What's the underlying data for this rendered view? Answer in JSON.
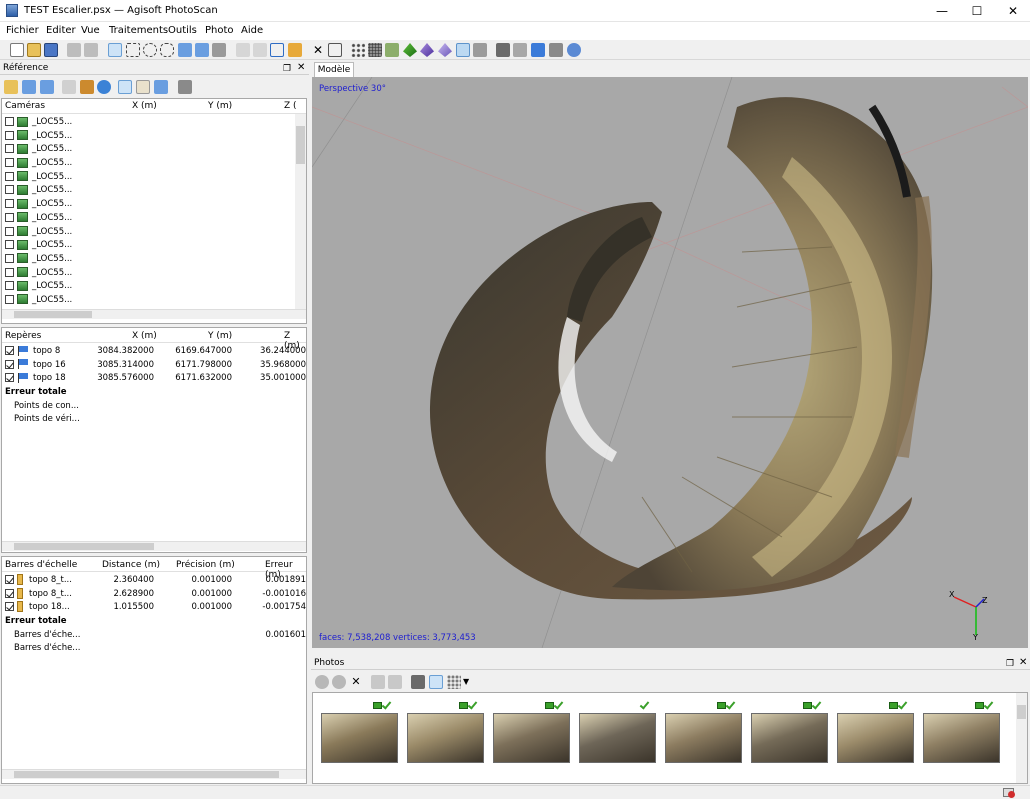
{
  "window": {
    "title": "TEST Escalier.psx — Agisoft PhotoScan",
    "min_icon": "minimize-icon",
    "max_icon": "maximize-icon",
    "close_icon": "close-icon"
  },
  "menu": [
    "Fichier",
    "Editer",
    "Vue",
    "Traitements",
    "Outils",
    "Photo",
    "Aide"
  ],
  "reference": {
    "title": "Référence",
    "cameras": {
      "headers": [
        "Caméras",
        "X (m)",
        "Y (m)",
        "Z ("
      ],
      "items": [
        "_LOC55...",
        "_LOC55...",
        "_LOC55...",
        "_LOC55...",
        "_LOC55...",
        "_LOC55...",
        "_LOC55...",
        "_LOC55...",
        "_LOC55...",
        "_LOC55...",
        "_LOC55...",
        "_LOC55...",
        "_LOC55...",
        "_LOC55..."
      ]
    },
    "markers": {
      "headers": [
        "Repères",
        "X (m)",
        "Y (m)",
        "Z (m)"
      ],
      "rows": [
        {
          "name": "topo 8",
          "x": "3084.382000",
          "y": "6169.647000",
          "z": "36.244000"
        },
        {
          "name": "topo 16",
          "x": "3085.314000",
          "y": "6171.798000",
          "z": "35.968000"
        },
        {
          "name": "topo 18",
          "x": "3085.576000",
          "y": "6171.632000",
          "z": "35.001000"
        }
      ],
      "total_label": "Erreur totale",
      "sub": [
        "Points de con...",
        "Points de véri..."
      ]
    },
    "scalebars": {
      "headers": [
        "Barres d'échelle",
        "Distance (m)",
        "Précision (m)",
        "Erreur (m)"
      ],
      "rows": [
        {
          "name": "topo 8_t...",
          "d": "2.360400",
          "p": "0.001000",
          "e": "0.001891"
        },
        {
          "name": "topo 8_t...",
          "d": "2.628900",
          "p": "0.001000",
          "e": "-0.001016"
        },
        {
          "name": "topo 18...",
          "d": "1.015500",
          "p": "0.001000",
          "e": "-0.001754"
        }
      ],
      "total_label": "Erreur totale",
      "sub": [
        "Barres d'éche...",
        "Barres d'éche..."
      ],
      "total_value": "0.001601"
    }
  },
  "model": {
    "tab": "Modèle",
    "perspective": "Perspective 30°",
    "stats": "faces: 7,538,208 vertices: 3,773,453",
    "axis_x": "X",
    "axis_y": "Y",
    "axis_z": "Z"
  },
  "photos": {
    "title": "Photos",
    "count": 8
  }
}
